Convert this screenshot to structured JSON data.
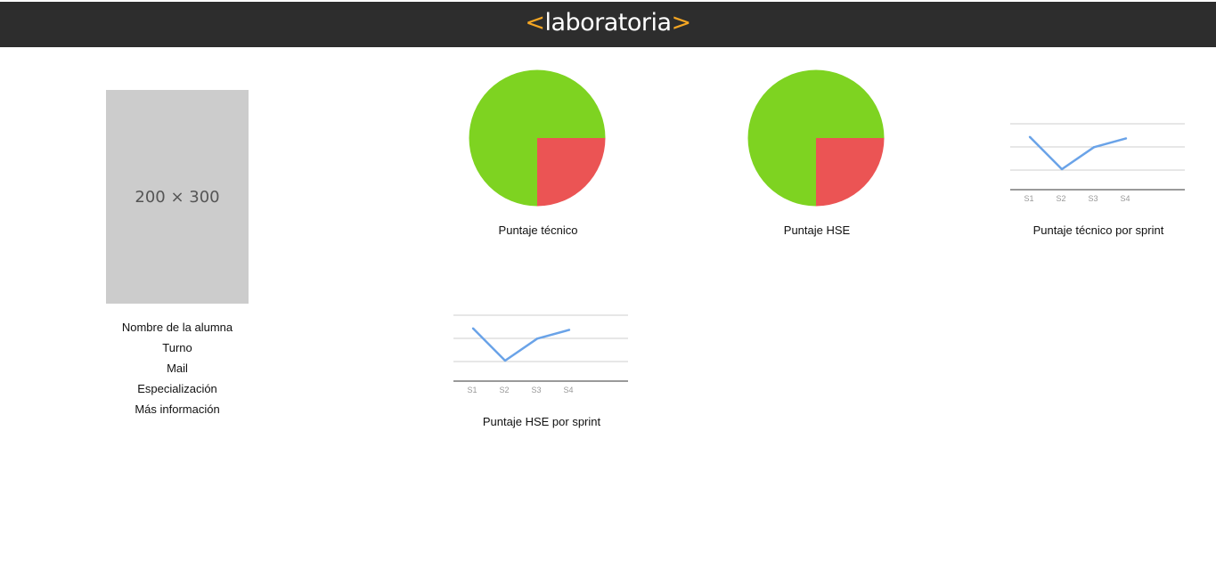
{
  "header": {
    "logo_open": "<",
    "logo_text": "laboratoria",
    "logo_close": ">"
  },
  "profile": {
    "photo_placeholder": "200 × 300",
    "name": "Nombre de la alumna",
    "shift": "Turno",
    "mail": "Mail",
    "specialization": "Especialización",
    "more_info": "Más información"
  },
  "colors": {
    "header_bg": "#2d2d2d",
    "logo_accent": "#f5a623",
    "pie_green": "#7ed321",
    "pie_red": "#eb5454",
    "line_blue": "#6aa3e8"
  },
  "chart_data": [
    {
      "type": "pie",
      "caption": "Puntaje técnico",
      "values": [
        75,
        25
      ]
    },
    {
      "type": "pie",
      "caption": "Puntaje HSE",
      "values": [
        75,
        25
      ]
    },
    {
      "type": "line",
      "caption": "Puntaje técnico por sprint",
      "categories": [
        "S1",
        "S2",
        "S3",
        "S4"
      ],
      "values": [
        3.6,
        1.4,
        2.9,
        3.5
      ],
      "ylim": [
        0,
        4.5
      ],
      "grid": true
    },
    {
      "type": "line",
      "caption": "Puntaje HSE por sprint",
      "categories": [
        "S1",
        "S2",
        "S3",
        "S4"
      ],
      "values": [
        3.6,
        1.4,
        2.9,
        3.5
      ],
      "ylim": [
        0,
        4.5
      ],
      "grid": true
    }
  ]
}
